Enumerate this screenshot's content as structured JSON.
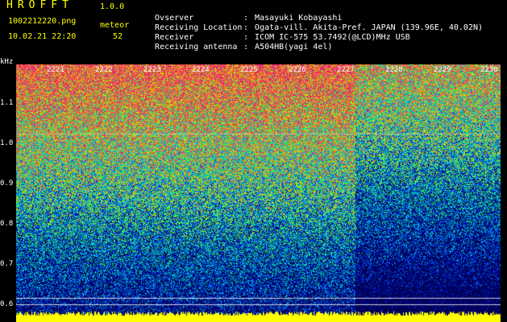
{
  "header": {
    "app_title": "HROFFT",
    "app_version": "1.0.0",
    "file_name": "1002212220.png",
    "mode_label": "meteor",
    "date_time": "10.02.21 22:20",
    "count_value": "52"
  },
  "info": [
    {
      "label": "Ovserver",
      "value": "Masayuki Kobayashi"
    },
    {
      "label": "Receiving Location",
      "value": "Ogata-vill. Akita-Pref. JAPAN (139.96E, 40.02N)"
    },
    {
      "label": "Receiver",
      "value": "ICOM IC-575 53.7492(@LCD)MHz USB"
    },
    {
      "label": "Receiving antenna",
      "value": "A504HB(yagi 4el)"
    }
  ],
  "yaxis": {
    "unit": "kHz",
    "labels": [
      "1.1",
      "1.0",
      "0.9",
      "0.8",
      "0.7",
      "0.6"
    ]
  },
  "time_ticks": [
    "2221",
    "2222",
    "2223",
    "2224",
    "2225",
    "2226",
    "2227",
    "2228",
    "2229",
    "2230"
  ],
  "colors": {
    "header_text": "#ffff00",
    "info_text": "#ffffff",
    "bottom_band": "#ffff00",
    "signal_line": "#ffffff"
  }
}
